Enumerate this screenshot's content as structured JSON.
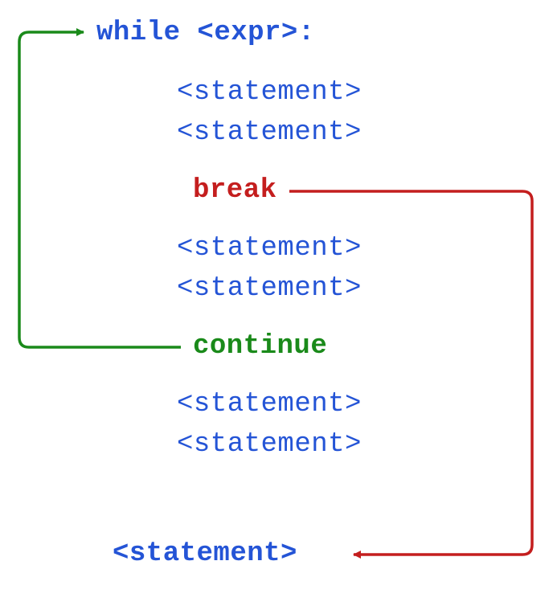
{
  "diagram": {
    "while_header": "while <expr>:",
    "stmt1": "<statement>",
    "stmt2": "<statement>",
    "break_kw": "break",
    "stmt3": "<statement>",
    "stmt4": "<statement>",
    "continue_kw": "continue",
    "stmt5": "<statement>",
    "stmt6": "<statement>",
    "after_stmt": "<statement>"
  },
  "colors": {
    "blue": "#2454d6",
    "red": "#c41e1e",
    "green": "#1a8a1a"
  }
}
